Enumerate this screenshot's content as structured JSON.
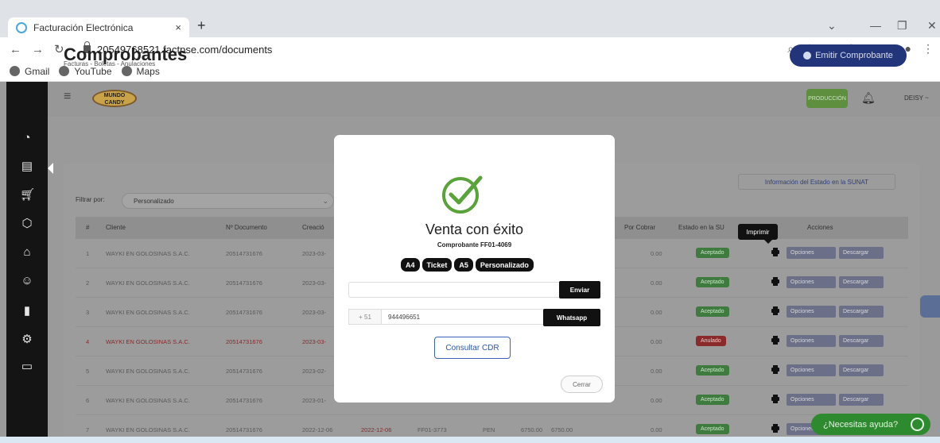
{
  "browser": {
    "tab_title": "Facturación Electrónica",
    "tab_close": "×",
    "new_tab": "+",
    "url": "20549768521.factpse.com/documents",
    "bookmarks": [
      "Gmail",
      "YouTube",
      "Maps"
    ]
  },
  "app": {
    "logo_text": "MUNDO CANDY",
    "env_badge": "PRODUCCIÓN",
    "user": "DEISY ~",
    "page_title": "Comprobantes",
    "page_subtitle": "Facturas - Boletas - Anulaciones",
    "emit_button": "Emitir Comprobante",
    "info_link": "Información del Estado en la SUNAT",
    "filter_label": "Filtrar por:",
    "filter_value": "Personalizado",
    "columns": [
      "#",
      "Cliente",
      "Nº Documento",
      "Creació",
      "Por Cobrar",
      "Estado en la SU",
      "Acciones"
    ],
    "tooltip": "Imprimir",
    "action_options": "Opciones",
    "action_download": "Descargar",
    "help_button": "¿Necesitas ayuda?",
    "rows": [
      {
        "n": "1",
        "client": "WAYKI EN GOLOSINAS S.A.C.",
        "doc": "20514731676",
        "date": "2023-03-",
        "due": "0.00",
        "status": "Aceptado",
        "ok": true
      },
      {
        "n": "2",
        "client": "WAYKI EN GOLOSINAS S.A.C.",
        "doc": "20514731676",
        "date": "2023-03-",
        "due": "0.00",
        "status": "Aceptado",
        "ok": true
      },
      {
        "n": "3",
        "client": "WAYKI EN GOLOSINAS S.A.C.",
        "doc": "20514731676",
        "date": "2023-03-",
        "due": "0.00",
        "status": "Aceptado",
        "ok": true
      },
      {
        "n": "4",
        "client": "WAYKI EN GOLOSINAS S.A.C.",
        "doc": "20514731676",
        "date": "2023-03-",
        "due": "0.00",
        "status": "Anulado",
        "ok": false
      },
      {
        "n": "5",
        "client": "WAYKI EN GOLOSINAS S.A.C.",
        "doc": "20514731676",
        "date": "2023-02-",
        "due": "0.00",
        "status": "Aceptado",
        "ok": true
      },
      {
        "n": "6",
        "client": "WAYKI EN GOLOSINAS S.A.C.",
        "doc": "20514731676",
        "date": "2023-01-",
        "due": "0.00",
        "status": "Aceptado",
        "ok": true
      },
      {
        "n": "7",
        "client": "WAYKI EN GOLOSINAS S.A.C.",
        "doc": "20514731676",
        "date": "2022-12-06",
        "date2": "2022-12-06",
        "series": "FF01-3773",
        "cur": "PEN",
        "total": "6750.00",
        "total2": "6750.00",
        "due": "0.00",
        "status": "Aceptado",
        "ok": true
      }
    ]
  },
  "modal": {
    "title": "Venta con éxito",
    "subtitle": "Comprobante FF01-4069",
    "formats": [
      "A4",
      "Ticket",
      "A5",
      "Personalizado"
    ],
    "send_button": "Enviar",
    "phone_prefix": "+ 51",
    "phone": "944496651",
    "whatsapp_button": "Whatsapp",
    "cdr_button": "Consultar CDR",
    "close_button": "Cerrar"
  },
  "colors": {
    "success": "#5aa33a",
    "primary": "#22357a",
    "dark": "#111111"
  }
}
